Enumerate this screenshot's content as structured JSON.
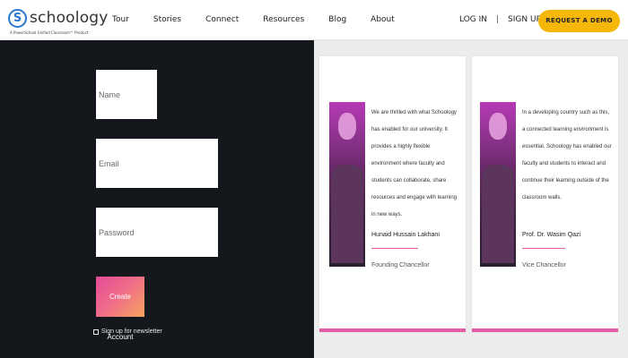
{
  "header": {
    "logo_mark": "S",
    "logo_text": "schoology",
    "logo_tagline": "A PowerSchool Unified Classroom™ Product",
    "nav": [
      "Tour",
      "Stories",
      "Connect",
      "Resources",
      "Blog",
      "About"
    ],
    "login_label": "LOG IN",
    "separator": "|",
    "signup_label": "SIGN UP",
    "demo_label": "REQUEST A DEMO"
  },
  "form": {
    "name_placeholder": "Name",
    "email_placeholder": "Email",
    "password_placeholder": "Password",
    "create_button": "Create Account",
    "consent_text": "Sign up for newsletter"
  },
  "testimonials": [
    {
      "quote": "We are thrilled with what Schoology has enabled for our university. It provides a highly flexible environment where faculty and students can collaborate, share resources and engage with learning in new ways.",
      "name": "Hunaid Hussain Lakhani",
      "role": "Founding Chancellor"
    },
    {
      "quote": "In a developing country such as this, a connected learning environment is essential. Schoology has enabled our faculty and students to interact and continue their learning outside of the classroom walls.",
      "name": "Prof. Dr. Wasim Qazi",
      "role": "Vice Chancellor"
    }
  ],
  "colors": {
    "brand_blue": "#2b78d0",
    "demo_yellow": "#f5b70a",
    "dark_panel": "#14171b",
    "accent_pink": "#e25ba6"
  },
  "icons": {
    "logo": "schoology-logo-icon",
    "photo": "portrait-photo"
  }
}
